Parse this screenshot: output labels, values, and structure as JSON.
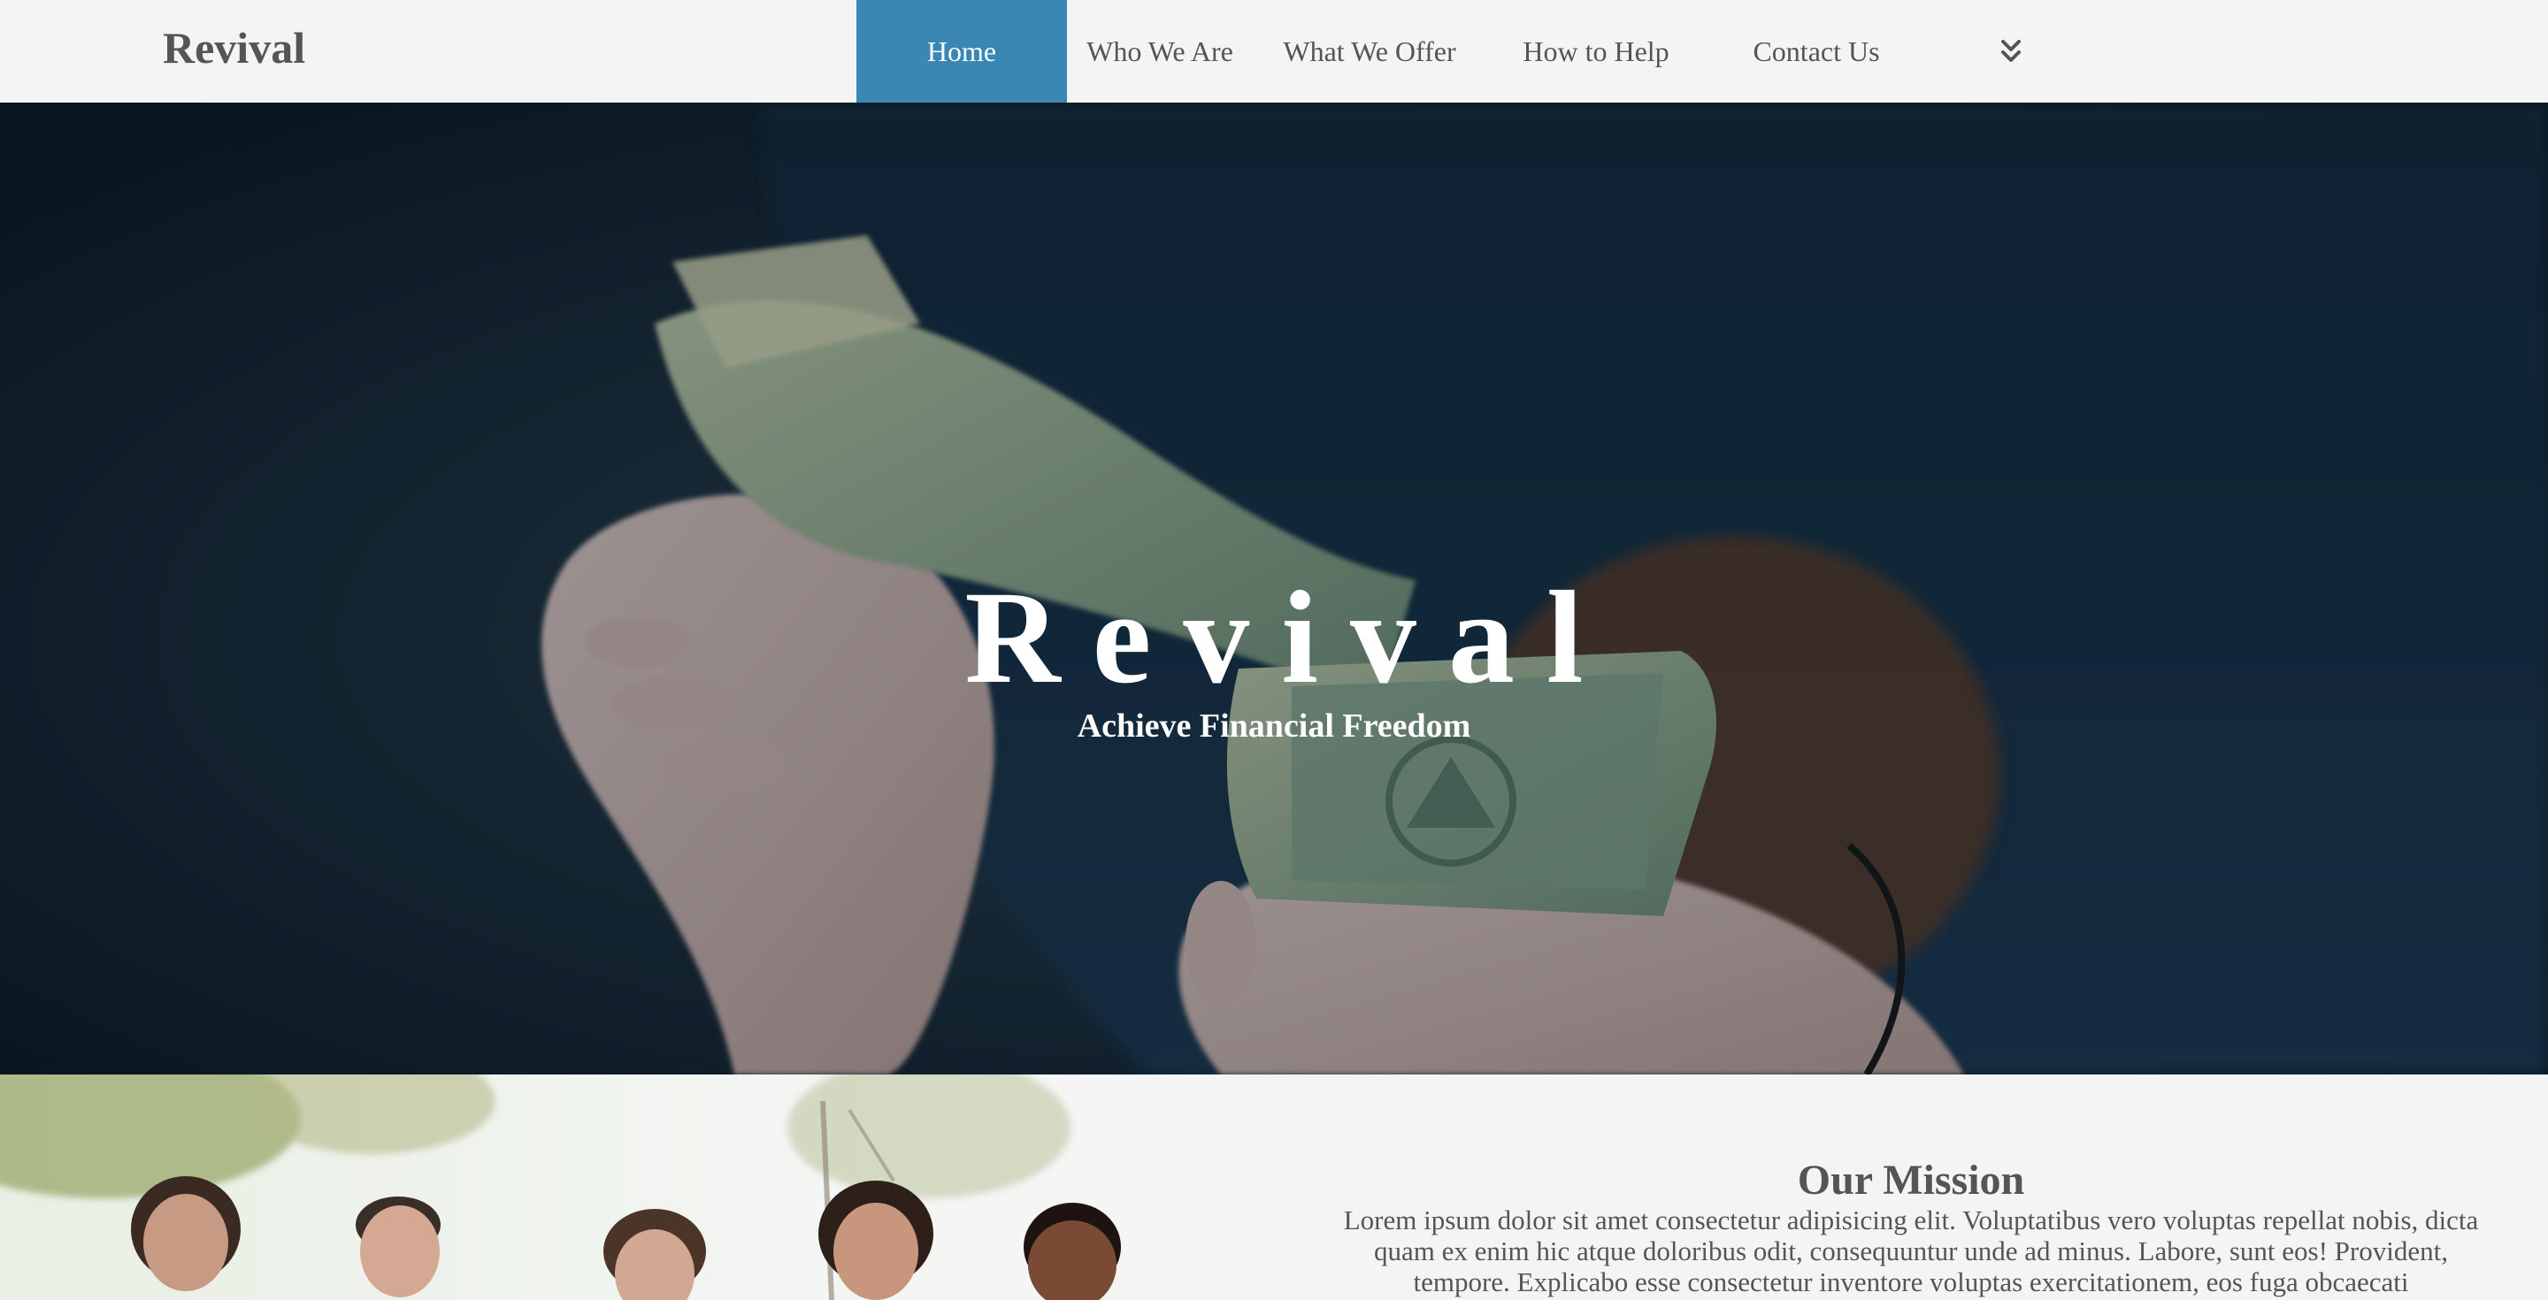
{
  "brand": {
    "name": "Revival"
  },
  "nav": {
    "items": [
      {
        "label": "Home",
        "active": true
      },
      {
        "label": "Who We Are",
        "active": false
      },
      {
        "label": "What We Offer",
        "active": false
      },
      {
        "label": "How to Help",
        "active": false
      },
      {
        "label": "Contact Us",
        "active": false
      }
    ],
    "more_icon": "double-chevron-down-icon"
  },
  "hero": {
    "title": "Revival",
    "subtitle": "Achieve Financial Freedom",
    "image": "hands-holding-dollar-bills"
  },
  "mission": {
    "title": "Our Mission",
    "body": "Lorem ipsum dolor sit amet consectetur adipisicing elit. Voluptatibus vero voluptas repellat nobis, dicta quam ex enim hic atque doloribus odit, consequuntur unde ad minus. Labore, sunt eos! Provident, tempore. Explicabo esse consectetur inventore voluptas exercitationem, eos fuga obcaecati",
    "image": "group-of-smiling-people-outdoors"
  },
  "colors": {
    "accent": "#3a86b4",
    "nav_background": "#f4f4f4",
    "text": "#555555",
    "hero_text": "#ffffff"
  }
}
